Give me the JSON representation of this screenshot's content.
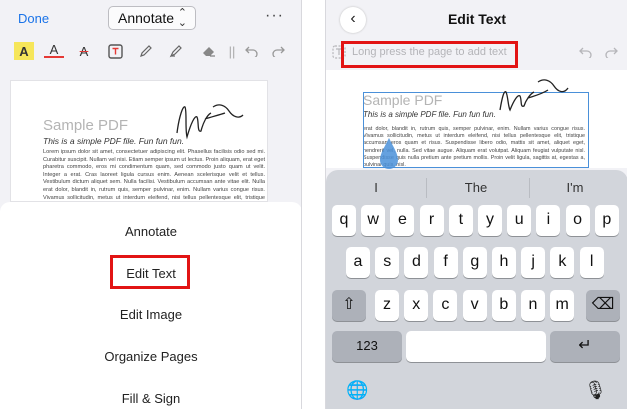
{
  "left": {
    "done_label": "Done",
    "mode_label": "Annotate",
    "more_label": "···",
    "tools": [
      "highlight-icon",
      "text-color-icon",
      "strikethrough-icon",
      "textbox-icon",
      "pencil-icon",
      "marker-icon",
      "eraser-icon",
      "separator-icon",
      "undo-icon",
      "redo-icon"
    ],
    "doc": {
      "title": "Sample PDF",
      "subtitle": "This is a simple PDF file. Fun fun fun.",
      "body": "Lorem ipsum dolor sit amet, consectetuer adipiscing elit. Phasellus facilisis odio sed mi. Curabitur suscipit. Nullam vel nisi. Etiam semper ipsum ut lectus. Proin aliquam, erat eget pharetra commodo, eros mi condimentum quam, sed commodo justo quam ut velit. Integer a erat. Cras laoreet ligula cursus enim. Aenean scelerisque velit et tellus. Vestibulum dictum aliquet sem. Nulla facilisi. Vestibulum accumsan ante vitae elit. Nulla erat dolor, blandit in, rutrum quis, semper pulvinar, enim. Nullam varius congue risus. Vivamus sollicitudin, metus ut interdum eleifend, nisi tellus pellentesque elit, tristique accumsan eros quam et risus. Suspendisse libero odio, mattis sit amet, aliquet eget, hendrerit vel, nulla. Sed vitae augue. Aliquam erat volutpat."
    },
    "menu": [
      "Annotate",
      "Edit Text",
      "Edit Image",
      "Organize Pages",
      "Fill & Sign"
    ]
  },
  "right": {
    "back_label": "‹",
    "title": "Edit Text",
    "hint": "Long press the page to add text",
    "doc": {
      "title": "Sample PDF",
      "subtitle": "This is a simple PDF file. Fun fun fun.",
      "body": "erat dolor, blandit in, rutrum quis, semper pulvinar, enim. Nullam varius congue risus. Vivamus sollicitudin, metus ut interdum eleifend, nisi tellus pellentesque elit, tristique accumsan eros quam et risus. Suspendisse libero odio, mattis sit amet, aliquet eget, hendrerit vel, nulla. Sed vitae augue. Aliquam erat volutpat. Aliquam feugiat vulputate nisl. Suspendisse quis nulla pretium ante pretium mollis. Proin velit ligula, sagittis at, egestas a, pulvinar quis, nisl."
    },
    "suggestions": [
      "I",
      "The",
      "I'm"
    ],
    "rows": [
      [
        "q",
        "w",
        "e",
        "r",
        "t",
        "y",
        "u",
        "i",
        "o",
        "p"
      ],
      [
        "a",
        "s",
        "d",
        "f",
        "g",
        "h",
        "j",
        "k",
        "l"
      ],
      [
        "z",
        "x",
        "c",
        "v",
        "b",
        "n",
        "m"
      ]
    ],
    "shift_label": "⇧",
    "delete_label": "⌫",
    "numbers_label": "123",
    "return_label": "↵",
    "globe_label": "🌐",
    "mic_label": "🎙"
  },
  "colors": {
    "accent": "#1a73e8",
    "highlight_box": "#e21414",
    "selection": "#4a90d9"
  }
}
